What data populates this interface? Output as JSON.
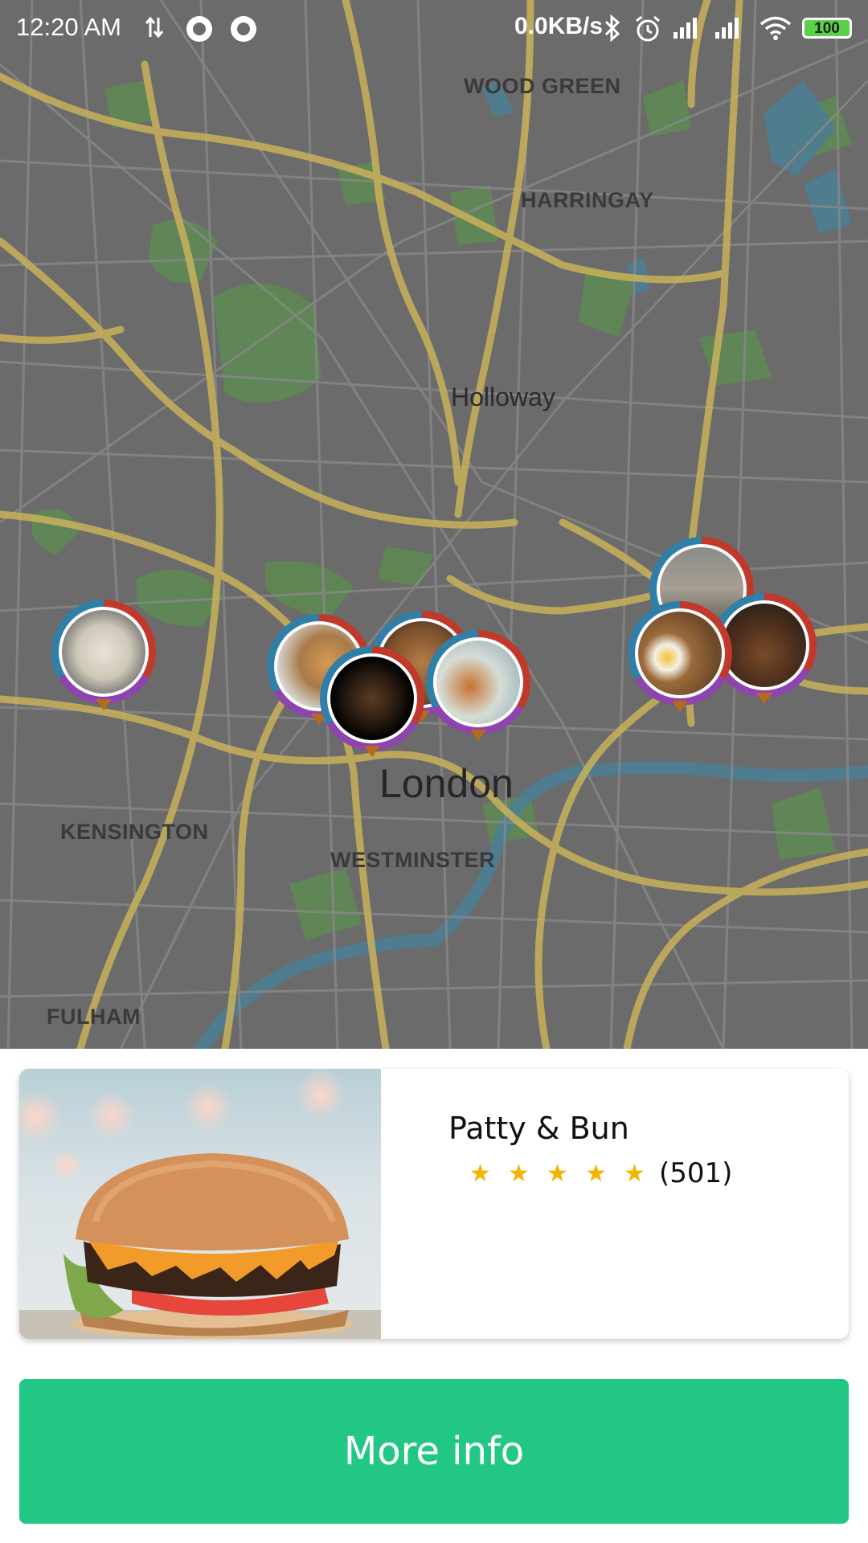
{
  "status_bar": {
    "time": "12:20 AM",
    "network_speed": "0.0KB/s",
    "battery": "100",
    "icons": [
      "data-transfer-icon",
      "record-icon",
      "record-icon",
      "bluetooth-icon",
      "alarm-icon",
      "signal-icon",
      "signal-icon",
      "wifi-icon",
      "battery-icon"
    ]
  },
  "map": {
    "labels": {
      "wood_green": "WOOD GREEN",
      "harringay": "HARRINGAY",
      "holloway": "Holloway",
      "london": "London",
      "kensington": "KENSINGTON",
      "westminster": "WESTMINSTER",
      "fulham": "FULHAM"
    },
    "markers": [
      {
        "name": "restaurant-marker-1"
      },
      {
        "name": "restaurant-marker-2"
      },
      {
        "name": "restaurant-marker-3"
      },
      {
        "name": "restaurant-marker-4"
      },
      {
        "name": "restaurant-marker-5"
      },
      {
        "name": "restaurant-marker-6"
      },
      {
        "name": "restaurant-marker-7"
      },
      {
        "name": "restaurant-marker-8"
      }
    ],
    "colors": {
      "overlay": "#6b6b6b",
      "roads": "#c9b25a",
      "parks": "#5e8a52",
      "water": "#4d7e92"
    }
  },
  "card": {
    "name": "Patty & Bun",
    "rating": 5,
    "stars": [
      "★",
      "★",
      "★",
      "★",
      "★"
    ],
    "review_count": "(501)"
  },
  "button": {
    "label": "More info",
    "color": "#22c785"
  }
}
